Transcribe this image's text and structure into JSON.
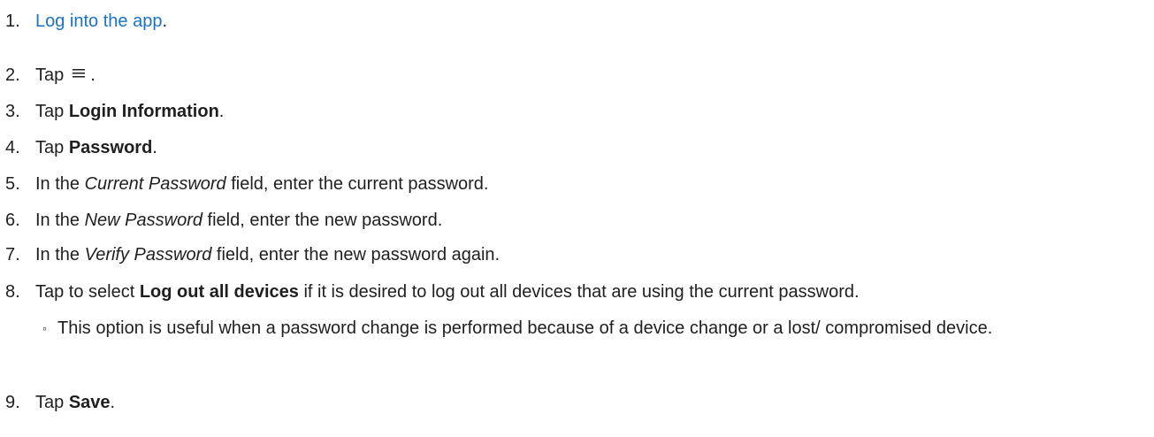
{
  "steps": [
    {
      "num": "1.",
      "link": "Log into the app",
      "end": "."
    },
    {
      "num": "2.",
      "pre": "Tap",
      "icon": "menu-icon",
      "end": "."
    },
    {
      "num": "3.",
      "pre": "Tap ",
      "bold": "Login Information",
      "end": "."
    },
    {
      "num": "4.",
      "pre": "Tap ",
      "bold": "Password",
      "end": "."
    },
    {
      "num": "5.",
      "pre": "In the ",
      "italic": "Current Password",
      "post": " field, enter the current password."
    },
    {
      "num": "6.",
      "pre": "In the ",
      "italic": "New Password",
      "post": " field, enter the new password."
    },
    {
      "num": "7.",
      "pre": "In the ",
      "italic": "Verify Password",
      "post": " field, enter the new password again."
    },
    {
      "num": "8.",
      "pre": "Tap to select ",
      "bold": "Log out all devices",
      "post": " if it is desired to log out all devices that are using the current password."
    },
    {
      "num": "9.",
      "pre": "Tap ",
      "bold": "Save",
      "end": "."
    }
  ],
  "sub_bullet": {
    "bullet": "◦",
    "text": "This option is useful when a password change is performed because of a device change or a lost/ compromised device."
  },
  "colors": {
    "link": "#1a73c4",
    "text": "#1f1f1f"
  }
}
